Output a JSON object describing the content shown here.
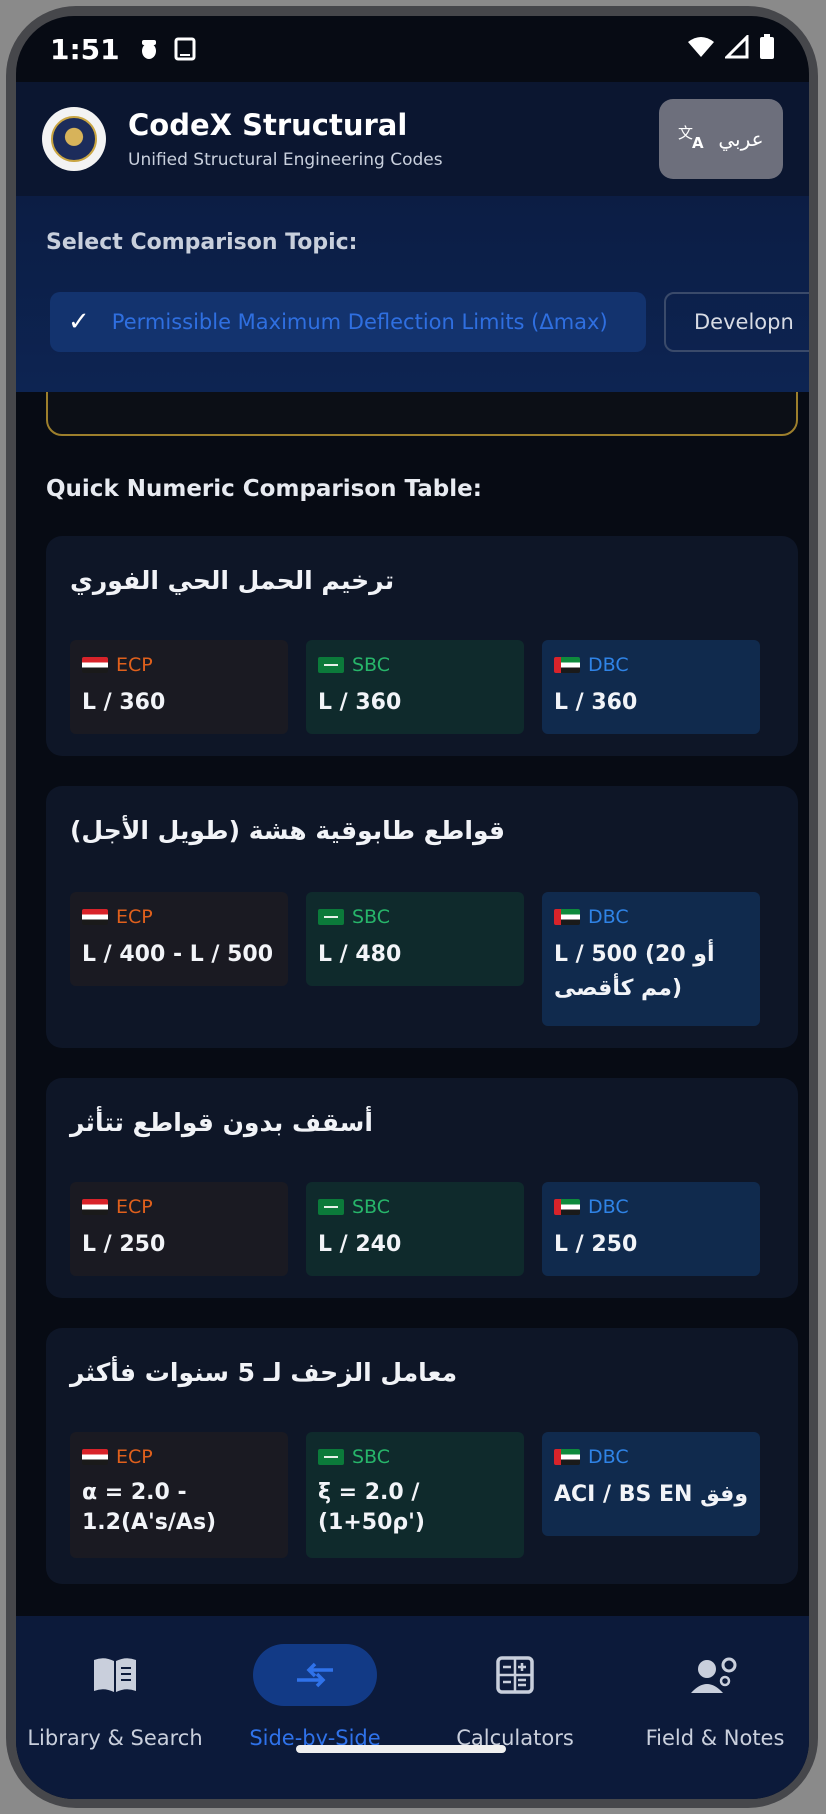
{
  "status": {
    "time": "1:51"
  },
  "header": {
    "title": "CodeX Structural",
    "subtitle": "Unified Structural Engineering Codes",
    "lang_label": "عربي"
  },
  "topic": {
    "label": "Select Comparison Topic:",
    "active": "Permissible Maximum Deflection Limits (Δmax)",
    "next": "Developn"
  },
  "section": {
    "title": "Quick Numeric Comparison Table:"
  },
  "codes": {
    "ecp": "ECP",
    "sbc": "SBC",
    "dbc": "DBC"
  },
  "rows": [
    {
      "title": "ترخيم الحمل الحي الفوري",
      "ecp": "L / 360",
      "sbc": "L / 360",
      "dbc": "L / 360"
    },
    {
      "title": "قواطع طابوقية هشة (طويل الأجل)",
      "ecp": "L / 400 - L / 500",
      "sbc": "L / 480",
      "dbc": "L / 500 (أو 20 مم كأقصى)"
    },
    {
      "title": "أسقف بدون قواطع تتأثر",
      "ecp": "L / 250",
      "sbc": "L / 240",
      "dbc": "L / 250"
    },
    {
      "title": "معامل الزحف لـ 5 سنوات فأكثر",
      "ecp": "α = 2.0 - 1.2(A's/As)",
      "sbc": "ξ = 2.0 / (1+50ρ')",
      "dbc": "وفق ACI / BS EN"
    }
  ],
  "nav": [
    {
      "label": "Library & Search",
      "icon": "book-icon"
    },
    {
      "label": "Side-by-Side",
      "icon": "compare-arrows-icon",
      "active": true
    },
    {
      "label": "Calculators",
      "icon": "calculator-icon"
    },
    {
      "label": "Field & Notes",
      "icon": "engineer-icon"
    }
  ]
}
